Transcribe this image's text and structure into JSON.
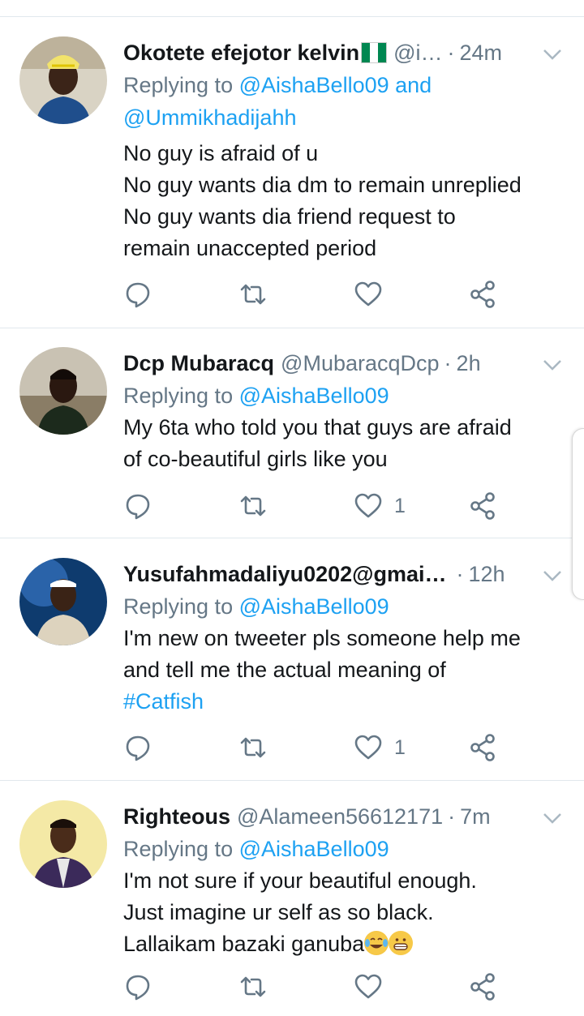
{
  "tweets": [
    {
      "name": "Okotete efejotor kelvin",
      "handle": "@i…",
      "sep": "·",
      "time": "24m",
      "has_flag": true,
      "replying_prefix": "Replying to ",
      "mentions_1": "@AishaBello09",
      "mentions_joiner": " and",
      "mentions_2": "@Ummikhadijahh",
      "lines": [
        "No guy is afraid of u",
        "No guy wants dia dm to remain unreplied",
        "No guy wants dia friend request to",
        "remain unaccepted period"
      ],
      "likes": ""
    },
    {
      "name": "Dcp Mubaracq",
      "handle": "@MubaracqDcp",
      "sep": "·",
      "time": "2h",
      "replying_prefix": "Replying to ",
      "mentions_1": "@AishaBello09",
      "lines": [
        "My 6ta who told you that guys are afraid",
        "of co-beautiful girls like you"
      ],
      "likes": "1"
    },
    {
      "name": "Yusufahmadaliyu0202@gmai…",
      "handle": "",
      "sep": "·",
      "time": "12h",
      "replying_prefix": "Replying to ",
      "mentions_1": "@AishaBello09",
      "lines": [
        "I'm new on tweeter pls someone help me",
        "and tell me the actual meaning of"
      ],
      "hashtag": "#Catfish",
      "likes": "1"
    },
    {
      "name": "Righteous",
      "handle": "@Alameen56612171",
      "sep": "·",
      "time": "7m",
      "replying_prefix": "Replying to ",
      "mentions_1": "@AishaBello09",
      "lines": [
        "I'm not sure if your beautiful enough.",
        "Just imagine ur self as so black.",
        "Lallaikam  bazaki ganuba"
      ],
      "emojis": [
        "face-with-tears-of-joy-emoji",
        "grinning-face-emoji"
      ],
      "likes": ""
    }
  ],
  "icons": {
    "reply": "reply-icon",
    "retweet": "retweet-icon",
    "like": "heart-icon",
    "share": "share-icon",
    "menu": "chevron-down-icon"
  },
  "colors": {
    "accent": "#1da1f2",
    "secondary_text": "#657786",
    "primary_text": "#14171a",
    "divider": "#e1e8ed"
  }
}
